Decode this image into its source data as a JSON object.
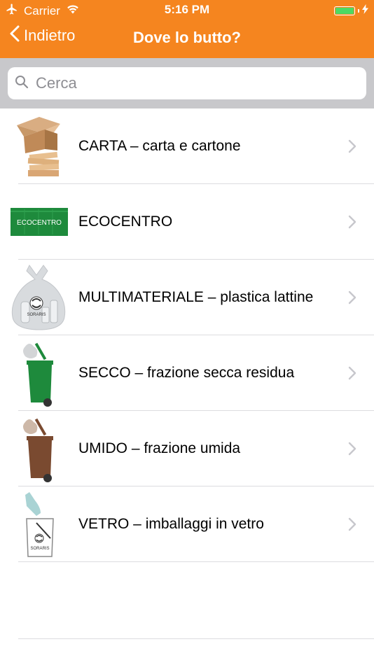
{
  "status_bar": {
    "carrier": "Carrier",
    "time": "5:16 PM"
  },
  "nav": {
    "back_label": "Indietro",
    "title": "Dove lo butto?"
  },
  "search": {
    "placeholder": "Cerca"
  },
  "list": {
    "items": [
      {
        "label": "CARTA – carta e cartone",
        "icon": "paper-cardboard-icon"
      },
      {
        "label": "ECOCENTRO",
        "icon": "ecocentro-container-icon",
        "icon_text": "ECOCENTRO"
      },
      {
        "label": "MULTIMATERIALE – plastica lattine",
        "icon": "multimaterial-bag-icon",
        "icon_text": "SORARIS"
      },
      {
        "label": "SECCO – frazione secca residua",
        "icon": "green-bin-icon"
      },
      {
        "label": "UMIDO – frazione umida",
        "icon": "brown-bin-icon"
      },
      {
        "label": "VETRO – imballaggi in vetro",
        "icon": "glass-bin-icon",
        "icon_text": "SORARIS"
      }
    ]
  },
  "colors": {
    "accent": "#f5851f",
    "search_bg": "#c8c8cb",
    "separator": "#dcdcdf",
    "chevron": "#c7c7cc",
    "green_bin": "#1e8a3c",
    "brown_bin": "#7a4a30"
  }
}
